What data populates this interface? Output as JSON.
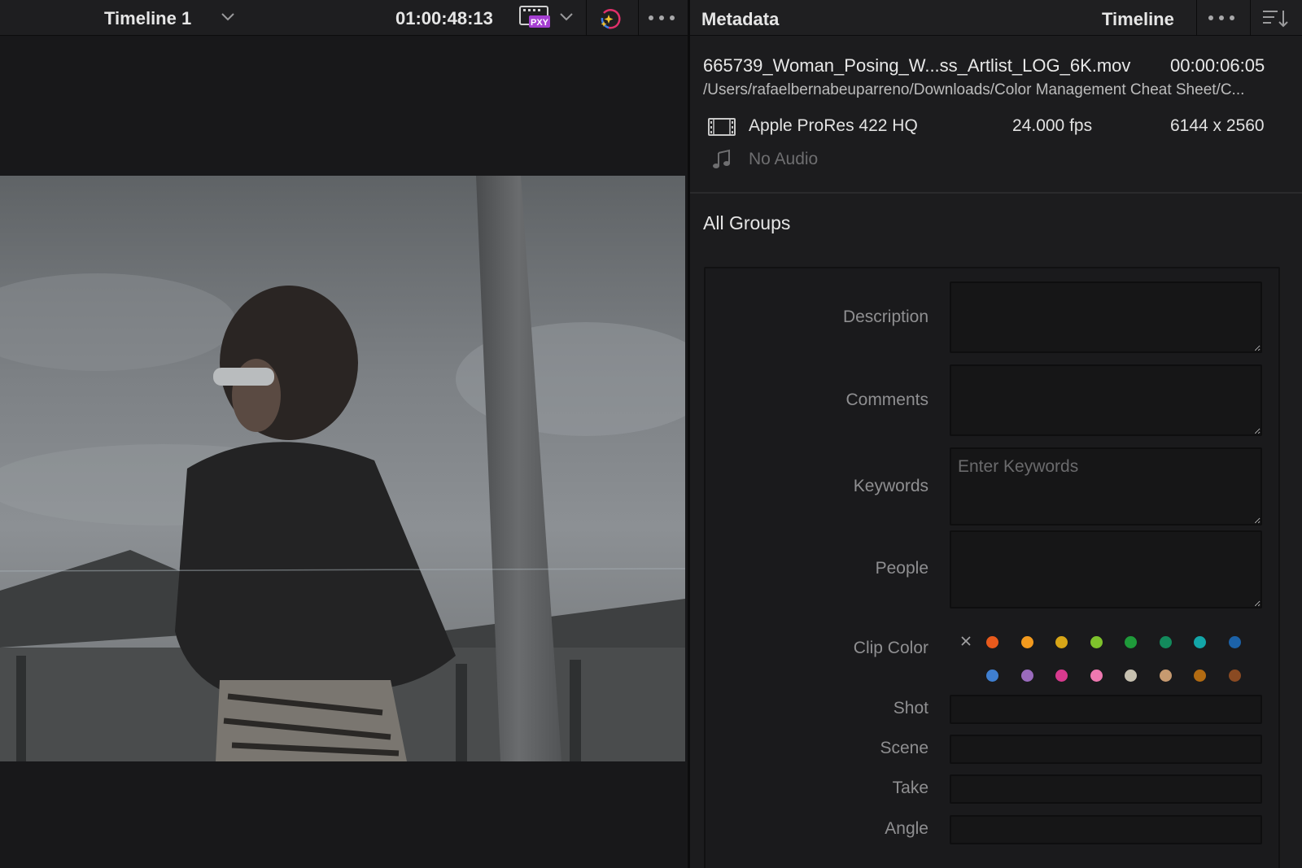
{
  "viewer": {
    "timeline_name": "Timeline 1",
    "timecode": "01:00:48:13",
    "proxy_badge": "PXY",
    "icons": [
      "chevron-down-icon",
      "proxy-icon",
      "magic-mask-icon",
      "more-options-icon"
    ]
  },
  "metadata": {
    "title": "Metadata",
    "mode": "Timeline",
    "clip": {
      "name": "665739_Woman_Posing_W...ss_Artlist_LOG_6K.mov",
      "duration": "00:00:06:05",
      "path": "/Users/rafaelbernabeuparreno/Downloads/Color Management Cheat Sheet/C...",
      "codec": "Apple ProRes 422 HQ",
      "fps": "24.000 fps",
      "resolution": "6144 x 2560",
      "audio": "No Audio"
    },
    "group": "All Groups",
    "fields": {
      "description": {
        "label": "Description",
        "value": ""
      },
      "comments": {
        "label": "Comments",
        "value": ""
      },
      "keywords": {
        "label": "Keywords",
        "placeholder": "Enter Keywords",
        "value": ""
      },
      "people": {
        "label": "People",
        "value": ""
      },
      "clip_color": {
        "label": "Clip Color"
      },
      "shot": {
        "label": "Shot",
        "value": ""
      },
      "scene": {
        "label": "Scene",
        "value": ""
      },
      "take": {
        "label": "Take",
        "value": ""
      },
      "angle": {
        "label": "Angle",
        "value": ""
      }
    },
    "clip_colors": [
      "#e85a1c",
      "#f39a1e",
      "#d8a617",
      "#7ec22c",
      "#1f9a3a",
      "#138a5c",
      "#13a6a8",
      "#1c62a8",
      "#3f7fd1",
      "#9a6bbd",
      "#d83a8e",
      "#ee78b0",
      "#c7c1b0",
      "#c79a70",
      "#b26b12",
      "#8a4a22"
    ]
  }
}
